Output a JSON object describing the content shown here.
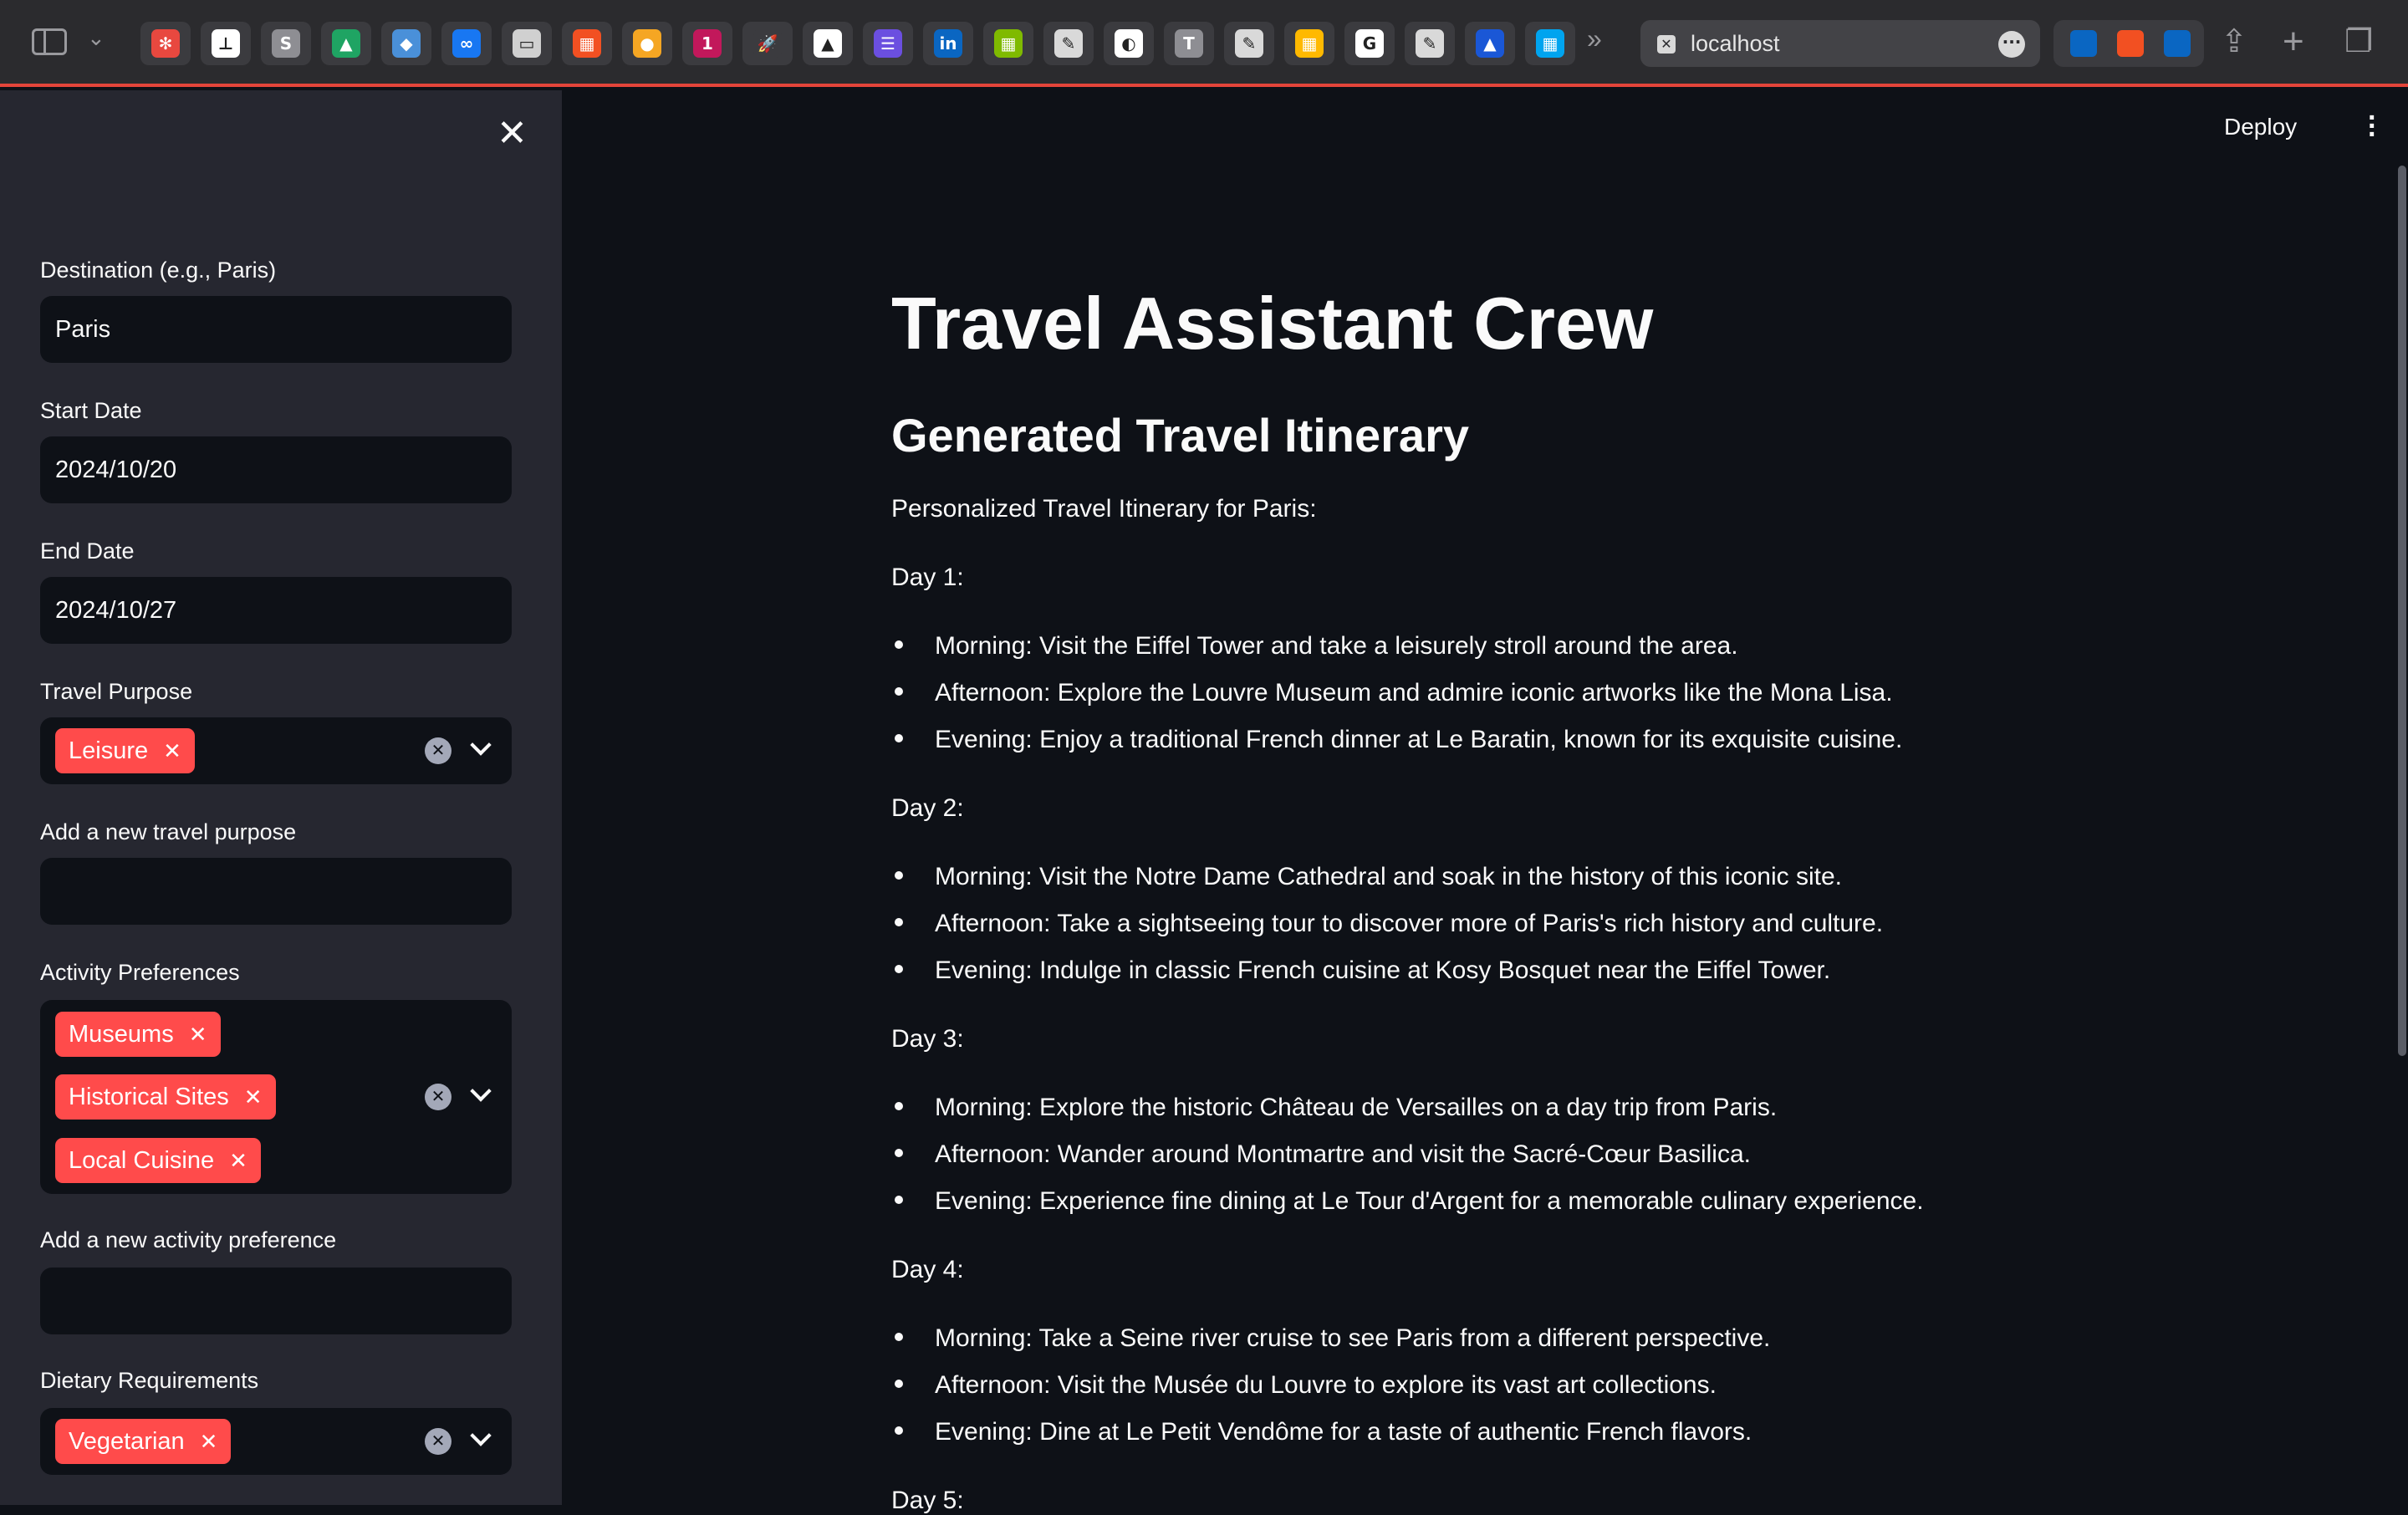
{
  "browser": {
    "address": "localhost",
    "bookmarks": [
      {
        "name": "bookmark-app-icon",
        "color": "#e8483f",
        "glyph": "✻"
      },
      {
        "name": "bookmark-app-icon",
        "color": "#ffffff",
        "glyph": "⊥"
      },
      {
        "name": "bookmark-s-icon",
        "color": "#8e8e93",
        "glyph": "S"
      },
      {
        "name": "bookmark-drive-icon",
        "color": "#1fa463",
        "glyph": "▲"
      },
      {
        "name": "bookmark-app-icon",
        "color": "#4a90d9",
        "glyph": "◆"
      },
      {
        "name": "bookmark-meta-icon",
        "color": "#1877f2",
        "glyph": "∞"
      },
      {
        "name": "bookmark-app-icon",
        "color": "#d0d0d0",
        "glyph": "▭"
      },
      {
        "name": "bookmark-microsoft-icon",
        "color": "#f25022",
        "glyph": "▦"
      },
      {
        "name": "bookmark-app-icon",
        "color": "#f5a623",
        "glyph": "●"
      },
      {
        "name": "bookmark-app-icon",
        "color": "#c2185b",
        "glyph": "1"
      },
      {
        "name": "bookmark-rocket-icon",
        "color": "#3b3b3f",
        "glyph": "🚀"
      },
      {
        "name": "bookmark-app-icon",
        "color": "#ffffff",
        "glyph": "▲"
      },
      {
        "name": "bookmark-list-icon",
        "color": "#6b4fe0",
        "glyph": "☰"
      },
      {
        "name": "bookmark-linkedin-icon",
        "color": "#0a66c2",
        "glyph": "in"
      },
      {
        "name": "bookmark-microsoft-icon",
        "color": "#7fba00",
        "glyph": "▦"
      },
      {
        "name": "bookmark-edit-icon",
        "color": "#d9d9d9",
        "glyph": "✎"
      },
      {
        "name": "bookmark-app-icon",
        "color": "#ffffff",
        "glyph": "◐"
      },
      {
        "name": "bookmark-t-icon",
        "color": "#8e8e93",
        "glyph": "T"
      },
      {
        "name": "bookmark-edit-icon",
        "color": "#d9d9d9",
        "glyph": "✎"
      },
      {
        "name": "bookmark-microsoft-icon",
        "color": "#ffb900",
        "glyph": "▦"
      },
      {
        "name": "bookmark-google-icon",
        "color": "#ffffff",
        "glyph": "G"
      },
      {
        "name": "bookmark-edit-icon",
        "color": "#d9d9d9",
        "glyph": "✎"
      },
      {
        "name": "bookmark-app-icon",
        "color": "#1a57d6",
        "glyph": "▲"
      },
      {
        "name": "bookmark-microsoft-icon",
        "color": "#00a4ef",
        "glyph": "▦"
      }
    ]
  },
  "sidebar": {
    "destination": {
      "label": "Destination (e.g., Paris)",
      "value": "Paris"
    },
    "start_date": {
      "label": "Start Date",
      "value": "2024/10/20"
    },
    "end_date": {
      "label": "End Date",
      "value": "2024/10/27"
    },
    "travel_purpose": {
      "label": "Travel Purpose",
      "chips": [
        "Leisure"
      ]
    },
    "new_purpose": {
      "label": "Add a new travel purpose",
      "value": ""
    },
    "activity_preferences": {
      "label": "Activity Preferences",
      "chips": [
        "Museums",
        "Historical Sites",
        "Local Cuisine"
      ]
    },
    "new_activity": {
      "label": "Add a new activity preference",
      "value": ""
    },
    "dietary": {
      "label": "Dietary Requirements",
      "chips": [
        "Vegetarian"
      ]
    }
  },
  "main": {
    "deploy_label": "Deploy",
    "title": "Travel Assistant Crew",
    "subheader": "Generated Travel Itinerary",
    "intro": "Personalized Travel Itinerary for Paris:",
    "days": [
      {
        "heading": "Day 1:",
        "items": [
          "Morning: Visit the Eiffel Tower and take a leisurely stroll around the area.",
          "Afternoon: Explore the Louvre Museum and admire iconic artworks like the Mona Lisa.",
          "Evening: Enjoy a traditional French dinner at Le Baratin, known for its exquisite cuisine."
        ]
      },
      {
        "heading": "Day 2:",
        "items": [
          "Morning: Visit the Notre Dame Cathedral and soak in the history of this iconic site.",
          "Afternoon: Take a sightseeing tour to discover more of Paris's rich history and culture.",
          "Evening: Indulge in classic French cuisine at Kosy Bosquet near the Eiffel Tower."
        ]
      },
      {
        "heading": "Day 3:",
        "items": [
          "Morning: Explore the historic Château de Versailles on a day trip from Paris.",
          "Afternoon: Wander around Montmartre and visit the Sacré-Cœur Basilica.",
          "Evening: Experience fine dining at Le Tour d'Argent for a memorable culinary experience."
        ]
      },
      {
        "heading": "Day 4:",
        "items": [
          "Morning: Take a Seine river cruise to see Paris from a different perspective.",
          "Afternoon: Visit the Musée du Louvre to explore its vast art collections.",
          "Evening: Dine at Le Petit Vendôme for a taste of authentic French flavors."
        ]
      },
      {
        "heading": "Day 5:",
        "items": []
      }
    ]
  }
}
